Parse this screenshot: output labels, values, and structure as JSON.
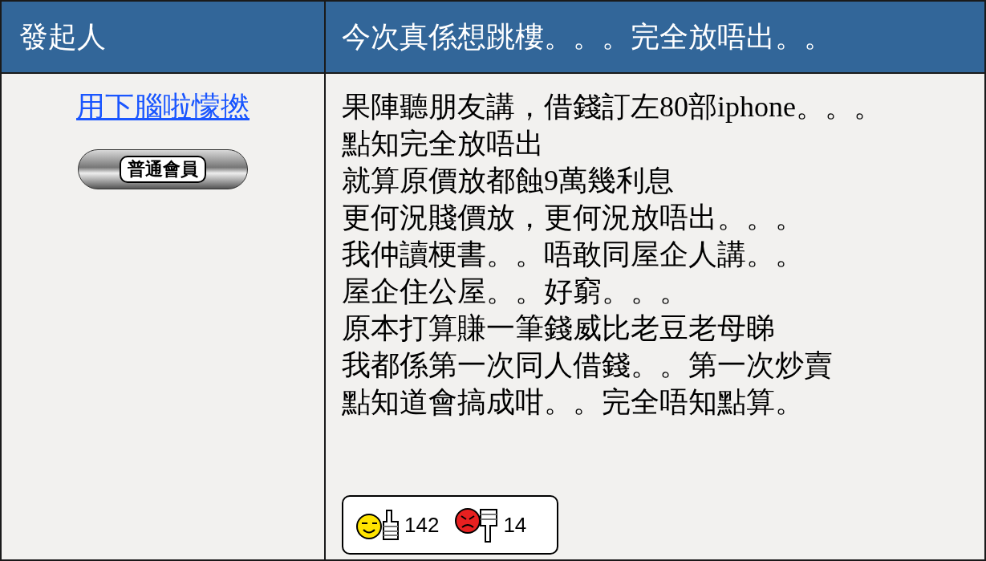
{
  "header": {
    "author_label": "發起人",
    "topic_title": "今次真係想跳樓。。。完全放唔出。。"
  },
  "author": {
    "name": "用下腦啦懞撚",
    "rank_badge": "普通會員"
  },
  "post": {
    "lines": [
      "果陣聽朋友講，借錢訂左80部iphone。。。",
      "點知完全放唔出",
      "就算原價放都蝕9萬幾利息",
      "更何況賤價放，更何況放唔出。。。",
      "我仲讀梗書。。唔敢同屋企人講。。",
      "屋企住公屋。。好窮。。。",
      "原本打算賺一筆錢威比老豆老母睇",
      "我都係第一次同人借錢。。第一次炒賣",
      "點知道會搞成咁。。完全唔知點算。"
    ],
    "ratings": [
      {
        "kind": "up",
        "count": "142"
      },
      {
        "kind": "down",
        "count": "14"
      }
    ]
  }
}
